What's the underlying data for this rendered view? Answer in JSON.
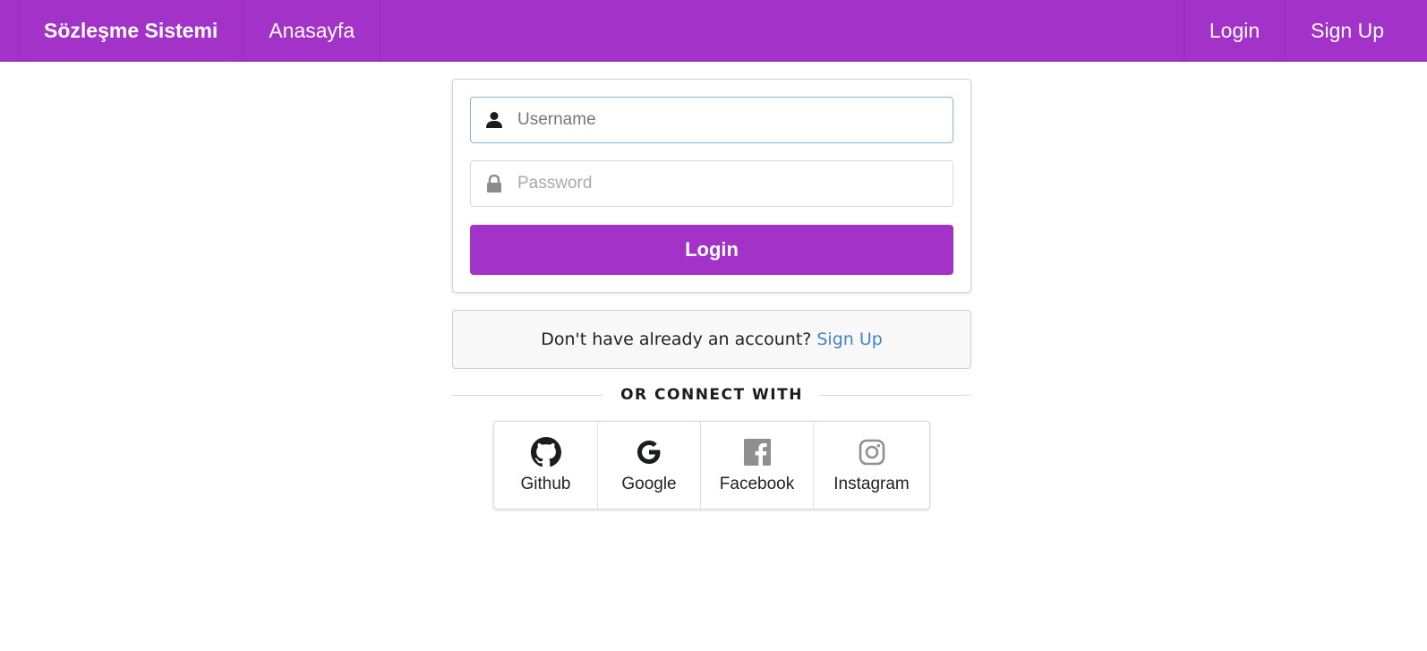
{
  "navbar": {
    "brand": "Sözleşme Sistemi",
    "home": "Anasayfa",
    "login": "Login",
    "signup": "Sign Up"
  },
  "login_form": {
    "username_placeholder": "Username",
    "password_placeholder": "Password",
    "submit_label": "Login"
  },
  "signup_message": {
    "text": "Don't have already an account?",
    "link": "Sign Up"
  },
  "divider": {
    "text": "OR CONNECT WITH"
  },
  "social": [
    {
      "label": "Github",
      "icon": "github-icon"
    },
    {
      "label": "Google",
      "icon": "google-icon"
    },
    {
      "label": "Facebook",
      "icon": "facebook-icon"
    },
    {
      "label": "Instagram",
      "icon": "instagram-icon"
    }
  ],
  "colors": {
    "primary": "#a333c8",
    "link": "#4183c4",
    "focus_border": "#85b7d9"
  }
}
